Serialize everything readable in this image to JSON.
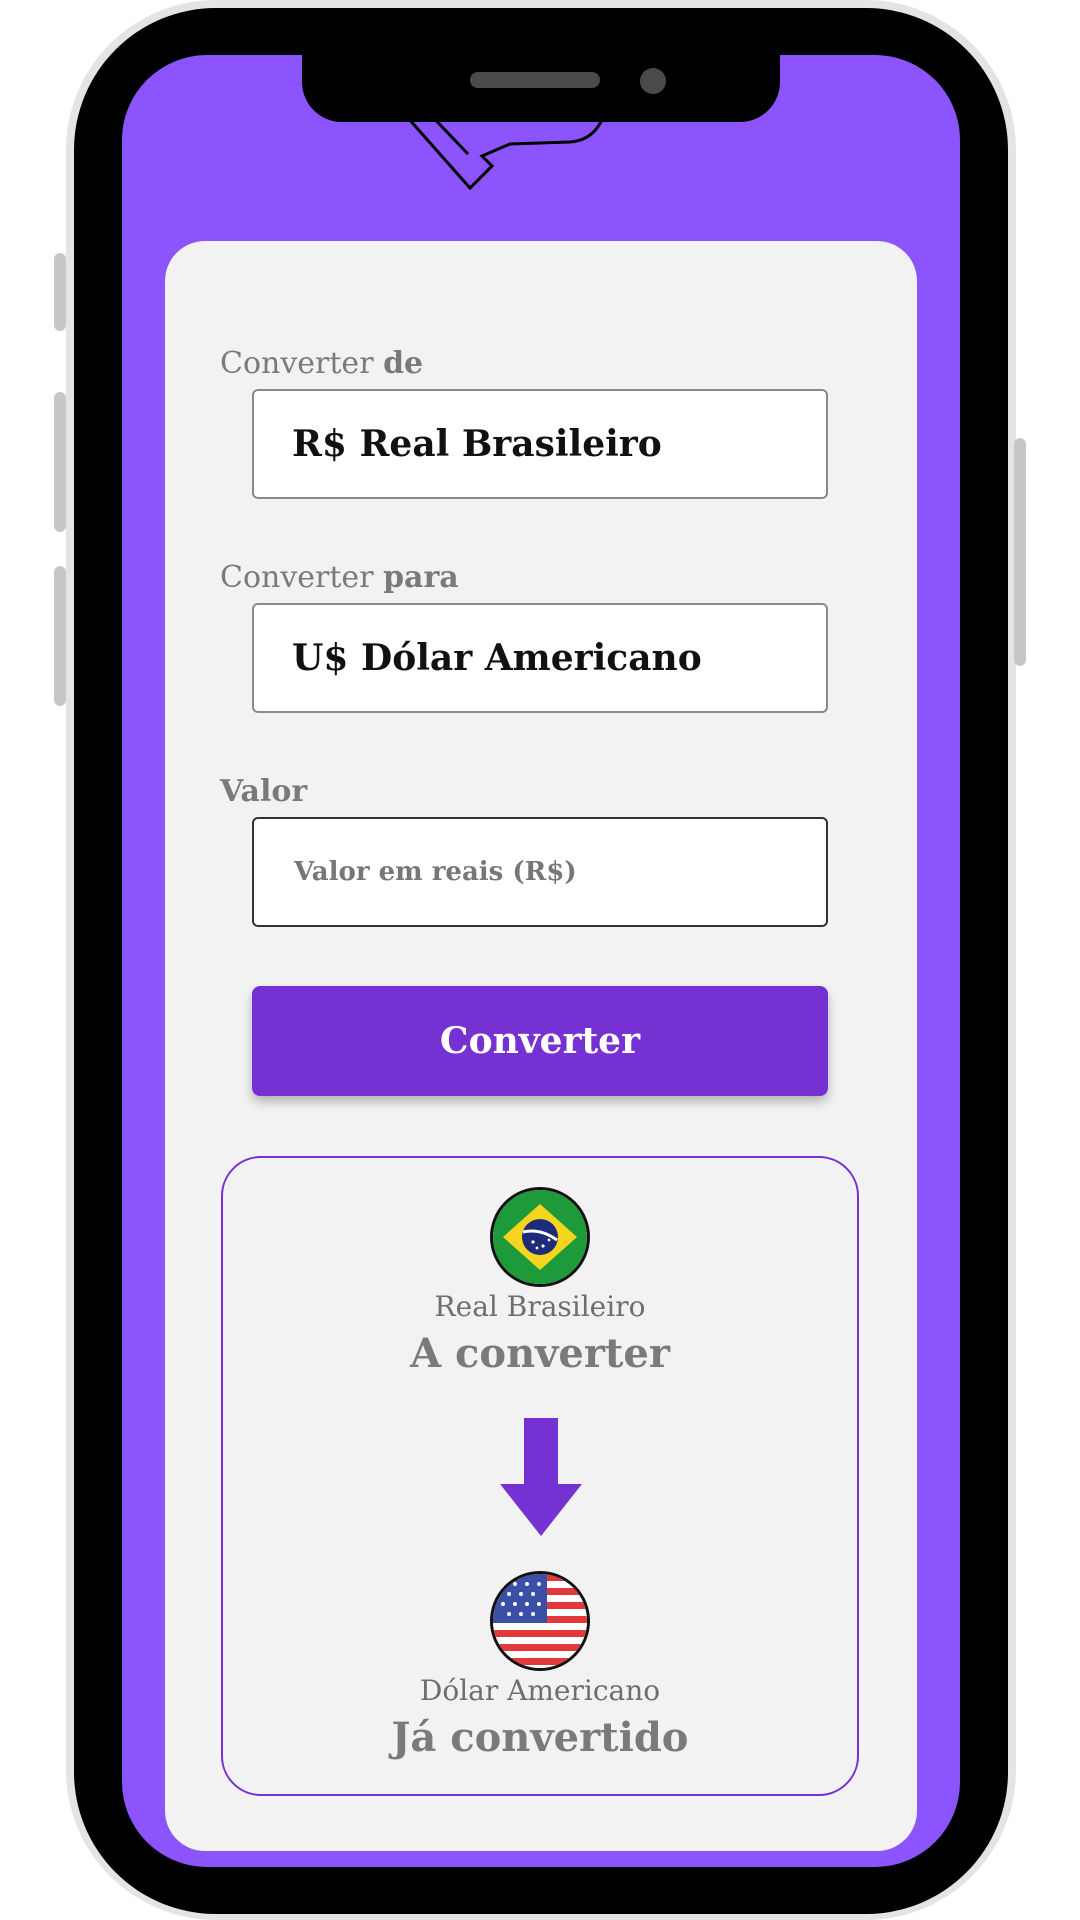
{
  "form": {
    "from_label_prefix": "Converter ",
    "from_label_bold": "de",
    "from_value": "R$ Real Brasileiro",
    "to_label_prefix": "Converter ",
    "to_label_bold": "para",
    "to_value": "U$ Dólar Americano",
    "amount_label": "Valor",
    "amount_placeholder": "Valor em reais (R$)",
    "amount_value": "",
    "convert_button": "Converter"
  },
  "result": {
    "source_currency": "Real Brasileiro",
    "source_status": "A converter",
    "target_currency": "Dólar Americano",
    "target_status": "Já convertido"
  },
  "colors": {
    "screen_background": "#8b54fc",
    "accent": "#7531d2",
    "card": "#f2f2f2"
  },
  "icons": [
    "brazil-flag-icon",
    "arrow-down-icon",
    "usa-flag-icon"
  ]
}
